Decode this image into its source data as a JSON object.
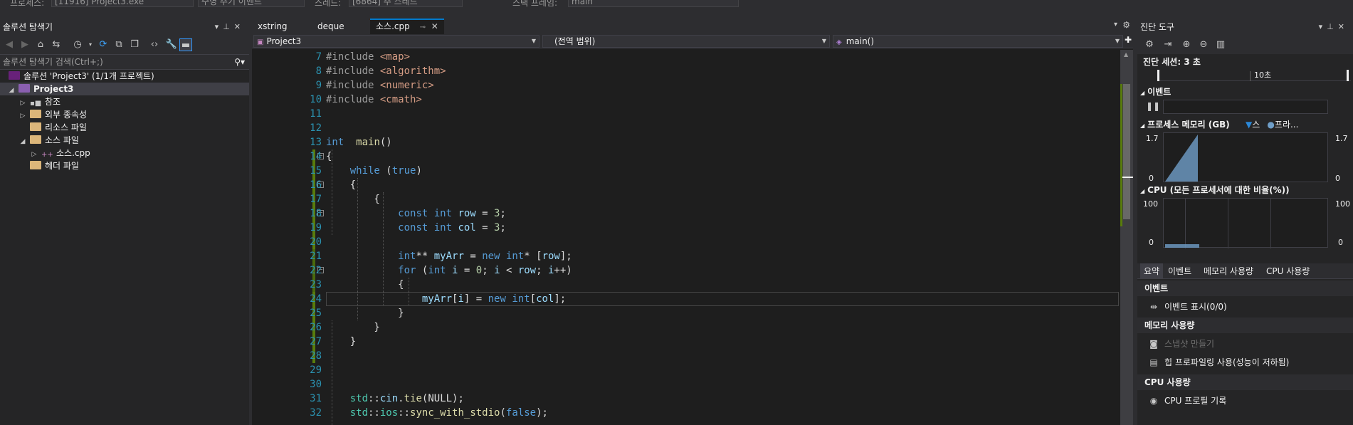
{
  "topbar": {
    "process_label": "프로세스:",
    "process_value": "[11916] Project3.exe",
    "lifecycle_label": "수명 주기 이벤트",
    "thread_label": "스레드:",
    "thread_value": "[6864] 주 스레드",
    "stack_label": "스택 프레임:",
    "stack_value": "main"
  },
  "solution_explorer": {
    "title": "솔루션 탐색기",
    "search_placeholder": "솔루션 탐색기 검색(Ctrl+;)",
    "tree": [
      {
        "label": "솔루션 'Project3' (1/1개 프로젝트)",
        "indent": 0,
        "expander": "",
        "icon": "solution-icon"
      },
      {
        "label": "Project3",
        "indent": 0,
        "expander": "▲",
        "icon": "project-icon",
        "bold": true
      },
      {
        "label": "참조",
        "indent": 1,
        "expander": "▷",
        "icon": "references-icon"
      },
      {
        "label": "외부 종속성",
        "indent": 1,
        "expander": "▷",
        "icon": "external-deps-icon"
      },
      {
        "label": "리소스 파일",
        "indent": 1,
        "expander": "",
        "icon": "folder-icon"
      },
      {
        "label": "소스 파일",
        "indent": 1,
        "expander": "◢",
        "icon": "folder-icon"
      },
      {
        "label": "소스.cpp",
        "indent": 2,
        "expander": "▷",
        "icon": "cpp-file-icon"
      },
      {
        "label": "헤더 파일",
        "indent": 1,
        "expander": "",
        "icon": "folder-icon"
      }
    ]
  },
  "editor": {
    "tabs": [
      {
        "label": "xstring",
        "active": false
      },
      {
        "label": "deque",
        "active": false
      },
      {
        "label": "소스.cpp",
        "active": true
      }
    ],
    "nav": {
      "project": "Project3",
      "scope": "(전역 범위)",
      "member": "main()"
    },
    "line_numbers": [
      "7",
      "8",
      "9",
      "10",
      "11",
      "12",
      "13",
      "14",
      "15",
      "16",
      "17",
      "18",
      "19",
      "20",
      "21",
      "22",
      "23",
      "24",
      "25",
      "26",
      "27",
      "28",
      "29",
      "30",
      "31",
      "32"
    ],
    "current_line": "24"
  },
  "diagnostics": {
    "title": "진단 도구",
    "session": "진단 세션: 3 초",
    "timeline_label": "10초",
    "events_header": "이벤트",
    "process_memory_header": "프로세스 메모리 (GB)",
    "memory_legend_1": "스",
    "memory_legend_2": "프라...",
    "memory_axis_max": "1.7",
    "memory_axis_min": "0",
    "cpu_header": "CPU (모든 프로세서에 대한 비율(%))",
    "cpu_axis_max": "100",
    "cpu_axis_min": "0",
    "tabs": [
      "요약",
      "이벤트",
      "메모리 사용량",
      "CPU 사용량"
    ],
    "summary": {
      "events_title": "이벤트",
      "show_events": "이벤트 표시(0/0)",
      "memory_title": "메모리 사용량",
      "snapshot": "스냅샷 만들기",
      "heap_profiling": "힙 프로파일링 사용(성능이 저하됨)",
      "cpu_title": "CPU 사용량",
      "cpu_profile": "CPU 프로필 기록"
    },
    "colors": {
      "graph_fill": "#6f9ec8",
      "legend_triangle": "#2b88d8"
    }
  }
}
